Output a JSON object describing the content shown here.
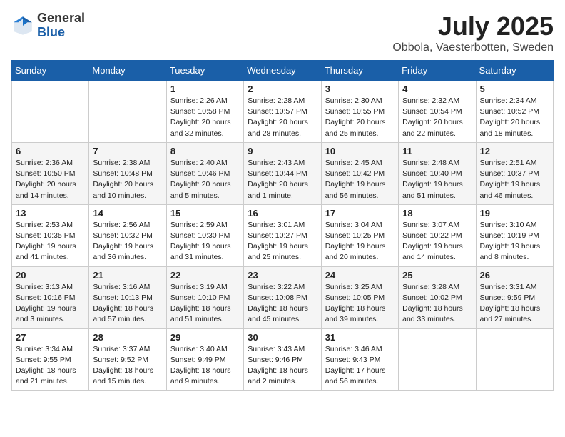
{
  "header": {
    "logo_general": "General",
    "logo_blue": "Blue",
    "month": "July 2025",
    "location": "Obbola, Vaesterbotten, Sweden"
  },
  "weekdays": [
    "Sunday",
    "Monday",
    "Tuesday",
    "Wednesday",
    "Thursday",
    "Friday",
    "Saturday"
  ],
  "weeks": [
    [
      {
        "day": "",
        "info": ""
      },
      {
        "day": "",
        "info": ""
      },
      {
        "day": "1",
        "info": "Sunrise: 2:26 AM\nSunset: 10:58 PM\nDaylight: 20 hours\nand 32 minutes."
      },
      {
        "day": "2",
        "info": "Sunrise: 2:28 AM\nSunset: 10:57 PM\nDaylight: 20 hours\nand 28 minutes."
      },
      {
        "day": "3",
        "info": "Sunrise: 2:30 AM\nSunset: 10:55 PM\nDaylight: 20 hours\nand 25 minutes."
      },
      {
        "day": "4",
        "info": "Sunrise: 2:32 AM\nSunset: 10:54 PM\nDaylight: 20 hours\nand 22 minutes."
      },
      {
        "day": "5",
        "info": "Sunrise: 2:34 AM\nSunset: 10:52 PM\nDaylight: 20 hours\nand 18 minutes."
      }
    ],
    [
      {
        "day": "6",
        "info": "Sunrise: 2:36 AM\nSunset: 10:50 PM\nDaylight: 20 hours\nand 14 minutes."
      },
      {
        "day": "7",
        "info": "Sunrise: 2:38 AM\nSunset: 10:48 PM\nDaylight: 20 hours\nand 10 minutes."
      },
      {
        "day": "8",
        "info": "Sunrise: 2:40 AM\nSunset: 10:46 PM\nDaylight: 20 hours\nand 5 minutes."
      },
      {
        "day": "9",
        "info": "Sunrise: 2:43 AM\nSunset: 10:44 PM\nDaylight: 20 hours\nand 1 minute."
      },
      {
        "day": "10",
        "info": "Sunrise: 2:45 AM\nSunset: 10:42 PM\nDaylight: 19 hours\nand 56 minutes."
      },
      {
        "day": "11",
        "info": "Sunrise: 2:48 AM\nSunset: 10:40 PM\nDaylight: 19 hours\nand 51 minutes."
      },
      {
        "day": "12",
        "info": "Sunrise: 2:51 AM\nSunset: 10:37 PM\nDaylight: 19 hours\nand 46 minutes."
      }
    ],
    [
      {
        "day": "13",
        "info": "Sunrise: 2:53 AM\nSunset: 10:35 PM\nDaylight: 19 hours\nand 41 minutes."
      },
      {
        "day": "14",
        "info": "Sunrise: 2:56 AM\nSunset: 10:32 PM\nDaylight: 19 hours\nand 36 minutes."
      },
      {
        "day": "15",
        "info": "Sunrise: 2:59 AM\nSunset: 10:30 PM\nDaylight: 19 hours\nand 31 minutes."
      },
      {
        "day": "16",
        "info": "Sunrise: 3:01 AM\nSunset: 10:27 PM\nDaylight: 19 hours\nand 25 minutes."
      },
      {
        "day": "17",
        "info": "Sunrise: 3:04 AM\nSunset: 10:25 PM\nDaylight: 19 hours\nand 20 minutes."
      },
      {
        "day": "18",
        "info": "Sunrise: 3:07 AM\nSunset: 10:22 PM\nDaylight: 19 hours\nand 14 minutes."
      },
      {
        "day": "19",
        "info": "Sunrise: 3:10 AM\nSunset: 10:19 PM\nDaylight: 19 hours\nand 8 minutes."
      }
    ],
    [
      {
        "day": "20",
        "info": "Sunrise: 3:13 AM\nSunset: 10:16 PM\nDaylight: 19 hours\nand 3 minutes."
      },
      {
        "day": "21",
        "info": "Sunrise: 3:16 AM\nSunset: 10:13 PM\nDaylight: 18 hours\nand 57 minutes."
      },
      {
        "day": "22",
        "info": "Sunrise: 3:19 AM\nSunset: 10:10 PM\nDaylight: 18 hours\nand 51 minutes."
      },
      {
        "day": "23",
        "info": "Sunrise: 3:22 AM\nSunset: 10:08 PM\nDaylight: 18 hours\nand 45 minutes."
      },
      {
        "day": "24",
        "info": "Sunrise: 3:25 AM\nSunset: 10:05 PM\nDaylight: 18 hours\nand 39 minutes."
      },
      {
        "day": "25",
        "info": "Sunrise: 3:28 AM\nSunset: 10:02 PM\nDaylight: 18 hours\nand 33 minutes."
      },
      {
        "day": "26",
        "info": "Sunrise: 3:31 AM\nSunset: 9:59 PM\nDaylight: 18 hours\nand 27 minutes."
      }
    ],
    [
      {
        "day": "27",
        "info": "Sunrise: 3:34 AM\nSunset: 9:55 PM\nDaylight: 18 hours\nand 21 minutes."
      },
      {
        "day": "28",
        "info": "Sunrise: 3:37 AM\nSunset: 9:52 PM\nDaylight: 18 hours\nand 15 minutes."
      },
      {
        "day": "29",
        "info": "Sunrise: 3:40 AM\nSunset: 9:49 PM\nDaylight: 18 hours\nand 9 minutes."
      },
      {
        "day": "30",
        "info": "Sunrise: 3:43 AM\nSunset: 9:46 PM\nDaylight: 18 hours\nand 2 minutes."
      },
      {
        "day": "31",
        "info": "Sunrise: 3:46 AM\nSunset: 9:43 PM\nDaylight: 17 hours\nand 56 minutes."
      },
      {
        "day": "",
        "info": ""
      },
      {
        "day": "",
        "info": ""
      }
    ]
  ]
}
